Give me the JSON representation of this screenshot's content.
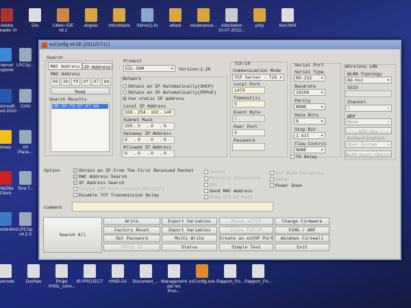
{
  "desktop": {
    "top_icons": [
      "Adobe Reader XI",
      "Dia",
      "Libero IDE v9.1",
      "anglais",
      "microblaze",
      "Xilinx(1).lic",
      "attack",
      "soutenance...",
      "Attestation 10-07-2012...",
      "poly",
      "test.html"
    ],
    "left_icons": [
      "Internet Explorer",
      "Microsoft Word 2010",
      "Avast",
      "FileZilla Client",
      "Thunderbird"
    ],
    "left_icons2": [
      "LPCXp...",
      "CAN",
      "XII Plane...",
      "Tera T...",
      "LPCXp v4.2.3"
    ],
    "bottom_icons": [
      "Evernote",
      "DocNav",
      "Projet VHDL_conv...",
      "IR-PROJECT",
      "HIND-5A",
      "Document_...",
      "Management par les Proc...",
      "ezConfig.exe",
      "Rapport_Po...",
      "Rapport_Po..."
    ]
  },
  "window": {
    "title": "ezConfig v4.5E (2011/07/11)"
  },
  "search": {
    "label": "Search",
    "tabs": [
      "MAC Address",
      "IP Address"
    ],
    "mac_label": "MAC Address",
    "mac": [
      "00",
      "30",
      "f9",
      "0f",
      "07",
      "bb"
    ],
    "read": "Read",
    "results_label": "Search Results",
    "results": [
      "00:30:f9:0f:07:bb"
    ]
  },
  "product": {
    "label": "Product",
    "value": "EZL-50M",
    "version": "Version:1.2K"
  },
  "network": {
    "label": "Network",
    "radios": [
      {
        "label": "Obtain an IP Automatically(DHCP)",
        "on": false
      },
      {
        "label": "Obtain an IP Automatically(PPPoE)",
        "on": false
      },
      {
        "label": "Use static IP address",
        "on": true
      }
    ],
    "local_ip_label": "Local IP Address",
    "local_ip": [
      "169",
      "254",
      "162",
      "140"
    ],
    "subnet_label": "Subnet Mask",
    "subnet": [
      "255",
      "0",
      "0",
      "0"
    ],
    "gateway_label": "Gateway IP Address",
    "gateway": [
      "0",
      "0",
      "0",
      "0"
    ],
    "allowed_label": "Allowed IP Address",
    "allowed": [
      "0",
      "0",
      "0",
      "0"
    ]
  },
  "tcpip": {
    "label": "TCP/IP",
    "mode_label": "Communication Mode",
    "mode": "TCP Server - T2S",
    "local_port_label": "Local Port",
    "local_port": "1470",
    "timeout_label": "Timeout(s)",
    "timeout": "5",
    "event_label": "Event Byte",
    "event": "0",
    "peer_label": "Peer Port",
    "peer": "0",
    "password_label": "Password",
    "password": ""
  },
  "serial": {
    "label": "Serial Port",
    "type_label": "Serial Type",
    "type": "RS-232",
    "baud_label": "Baudrate",
    "baud": "19200",
    "parity_label": "Parity",
    "parity": "NONE",
    "databits_label": "Data Bits",
    "databits": "8",
    "stopbit_label": "Stop Bit",
    "stopbit": "1 bit",
    "flow_label": "Flow Control",
    "flow": "NONE",
    "txdelay": "TX Delay"
  },
  "wlan": {
    "label": "Wireless LAN",
    "topology_label": "WLAN Topology",
    "topology": "Ad-hoc",
    "ssid_label": "SSID",
    "ssid": "",
    "channel_label": "Channel",
    "channel": "0",
    "wep_label": "WEP",
    "wep": "None",
    "wep_key": "WEP Key",
    "auth_label": "Authentication",
    "auth": "Open System",
    "start_option": "WLAN Start Option"
  },
  "option": {
    "label": "Option",
    "col1": [
      {
        "label": "Obtain an IP From The First Received Packet",
        "checked": true
      },
      {
        "label": "MAC Address Search",
        "checked": true
      },
      {
        "label": "IP Address Search",
        "checked": true
      },
      {
        "label": "Telnet COM Port Control(RFC2217)",
        "checked": false,
        "disabled": true
      },
      {
        "label": "Disable TCP Transmission Delay",
        "checked": false
      }
    ],
    "col2": [
      {
        "label": "Telnet",
        "checked": false,
        "disabled": true
      },
      {
        "label": "Multiple Connection",
        "checked": false,
        "disabled": true
      },
      {
        "label": "SSL",
        "checked": false,
        "disabled": true
      },
      {
        "label": "Send MAC Address",
        "checked": false
      },
      {
        "label": "Drop STO-RX Data",
        "checked": false,
        "disabled": true
      }
    ],
    "col3": [
      {
        "label": "Set WLAN Variables",
        "checked": false,
        "disabled": true
      },
      {
        "label": "EAPoL",
        "checked": false,
        "disabled": true
      },
      {
        "label": "Power Down",
        "checked": false
      }
    ]
  },
  "comment": {
    "label": "Comment",
    "value": ""
  },
  "buttons": {
    "search_all": "Search All",
    "grid": [
      [
        {
          "label": "Write"
        },
        {
          "label": "Export Variables"
        },
        {
          "label": "Reset ezTCP",
          "disabled": true
        },
        {
          "label": "Change Firmware"
        }
      ],
      [
        {
          "label": "Factory Reset"
        },
        {
          "label": "Import Variables"
        },
        {
          "label": "Close TCP/IP",
          "disabled": true
        },
        {
          "label": "PING / ARP"
        }
      ],
      [
        {
          "label": "Set Password"
        },
        {
          "label": "Multi Write"
        },
        {
          "label": "Create an ezVSP Port"
        },
        {
          "label": "Windows Firewall"
        }
      ],
      [
        {
          "label": "PPPoE ID",
          "disabled": true
        },
        {
          "label": "Status"
        },
        {
          "label": "Simple Test"
        },
        {
          "label": "Exit"
        }
      ]
    ]
  }
}
